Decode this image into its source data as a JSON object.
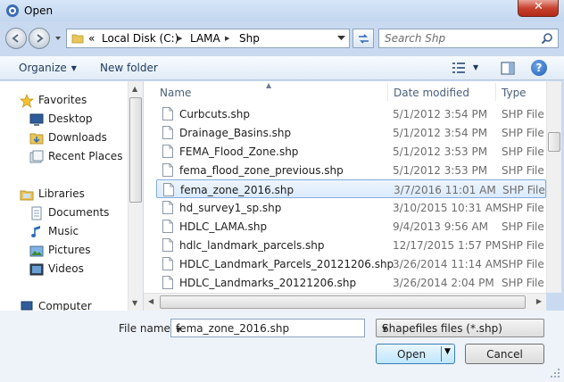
{
  "window": {
    "title": "Open",
    "close_glyph": "✕"
  },
  "address": {
    "overflow_glyph": "«",
    "crumbs": [
      "Local Disk (C:)",
      "LAMA",
      "Shp"
    ],
    "separator": "▶"
  },
  "search": {
    "placeholder": "Search Shp"
  },
  "toolbar": {
    "organize_label": "Organize",
    "new_folder_label": "New folder",
    "help_label": "?"
  },
  "nav": {
    "items": [
      {
        "label": "Favorites",
        "icon": "star-icon"
      },
      {
        "label": "Desktop",
        "icon": "desktop-icon"
      },
      {
        "label": "Downloads",
        "icon": "downloads-icon"
      },
      {
        "label": "Recent Places",
        "icon": "recent-places-icon"
      },
      {
        "label": "Libraries",
        "icon": "libraries-icon"
      },
      {
        "label": "Documents",
        "icon": "documents-icon"
      },
      {
        "label": "Music",
        "icon": "music-icon"
      },
      {
        "label": "Pictures",
        "icon": "pictures-icon"
      },
      {
        "label": "Videos",
        "icon": "videos-icon"
      },
      {
        "label": "Computer",
        "icon": "computer-icon"
      }
    ]
  },
  "columns": {
    "name": "Name",
    "date": "Date modified",
    "type": "Type"
  },
  "files": [
    {
      "name": "Curbcuts.shp",
      "date": "5/1/2012 3:54 PM",
      "type": "SHP File"
    },
    {
      "name": "Drainage_Basins.shp",
      "date": "5/1/2012 3:54 PM",
      "type": "SHP File"
    },
    {
      "name": "FEMA_Flood_Zone.shp",
      "date": "5/1/2012 3:53 PM",
      "type": "SHP File"
    },
    {
      "name": "fema_flood_zone_previous.shp",
      "date": "5/1/2012 3:53 PM",
      "type": "SHP File"
    },
    {
      "name": "fema_zone_2016.shp",
      "date": "3/7/2016 11:01 AM",
      "type": "SHP File",
      "selected": true
    },
    {
      "name": "hd_survey1_sp.shp",
      "date": "3/10/2015 10:31 AM",
      "type": "SHP File"
    },
    {
      "name": "HDLC_LAMA.shp",
      "date": "9/4/2013 9:56 AM",
      "type": "SHP File"
    },
    {
      "name": "hdlc_landmark_parcels.shp",
      "date": "12/17/2015 1:57 PM",
      "type": "SHP File"
    },
    {
      "name": "HDLC_Landmark_Parcels_20121206.shp",
      "date": "3/26/2014 11:14 AM",
      "type": "SHP File"
    },
    {
      "name": "HDLC_Landmarks_20121206.shp",
      "date": "3/26/2014 2:04 PM",
      "type": "SHP File"
    }
  ],
  "bottom": {
    "file_name_label": "File name:",
    "file_name_value": "fema_zone_2016.shp",
    "filter_value": "Shapefiles files (*.shp)",
    "open_label": "Open",
    "cancel_label": "Cancel"
  },
  "colors": {
    "selection": "#dbeafb",
    "selection_border": "#84acdd",
    "chrome": "#c9daf0",
    "link": "#1e3a5f"
  }
}
